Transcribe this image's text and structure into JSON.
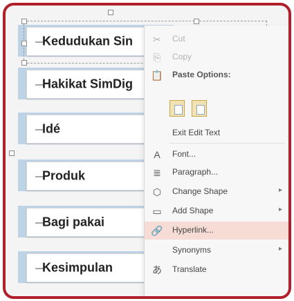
{
  "list": {
    "items": [
      {
        "label": "Kedudukan Sin"
      },
      {
        "label": "Hakikat SimDig"
      },
      {
        "label": "Idé"
      },
      {
        "label": "Produk"
      },
      {
        "label": "Bagi pakai"
      },
      {
        "label": "Kesimpulan"
      }
    ]
  },
  "menu": {
    "cut": "Cut",
    "copy": "Copy",
    "paste_options": "Paste Options:",
    "exit_edit_text": "Exit Edit Text",
    "font": "Font...",
    "paragraph": "Paragraph...",
    "change_shape": "Change Shape",
    "add_shape": "Add Shape",
    "hyperlink": "Hyperlink...",
    "synonyms": "Synonyms",
    "translate": "Translate"
  },
  "colors": {
    "frame_border": "#b01f2a",
    "item_bar": "#bfd3e6",
    "hover_highlight": "#f6dcd5"
  },
  "icons": {
    "cut": "scissors-icon",
    "copy": "copy-icon",
    "paste": "clipboard-icon",
    "font": "font-icon",
    "paragraph": "paragraph-icon",
    "change_shape": "change-shape-icon",
    "add_shape": "add-shape-icon",
    "hyperlink": "hyperlink-icon",
    "translate": "translate-icon"
  }
}
